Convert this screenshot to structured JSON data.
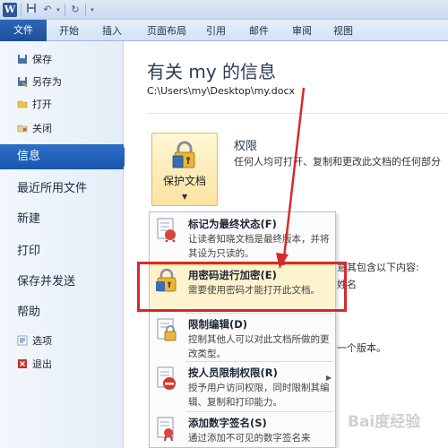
{
  "quick_access": {
    "logo": "W",
    "save_icon": "save-icon",
    "undo_icon": "undo-icon",
    "redo_icon": "redo-icon"
  },
  "tabs": [
    "文件",
    "开始",
    "插入",
    "页面布局",
    "引用",
    "邮件",
    "审阅",
    "视图"
  ],
  "nav": {
    "save": "保存",
    "save_as": "另存为",
    "open": "打开",
    "close": "关闭",
    "info": "信息",
    "recent": "最近所用文件",
    "new": "新建",
    "print": "打印",
    "save_send": "保存并发送",
    "help": "帮助",
    "options": "选项",
    "exit": "退出"
  },
  "main": {
    "title": "有关 my 的信息",
    "path": "C:\\Users\\my\\Desktop\\my.docx",
    "protect_label": "保护文档",
    "permissions_title": "权限",
    "permissions_desc": "任何人均可打开、复制和更改此文档的任何部分",
    "check_text": "意其包含以下内容:",
    "author_text": "姓名",
    "version_text": "一个版本。"
  },
  "menu": {
    "items": [
      {
        "title": "标记为最终状态(F)",
        "desc": "让读者知晓文档是最终版本，并将其设为只读的。"
      },
      {
        "title": "用密码进行加密(E)",
        "desc": "需要使用密码才能打开此文档。"
      },
      {
        "title": "限制编辑(D)",
        "desc": "控制其他人可以对此文档所做的更改类型。"
      },
      {
        "title": "按人员限制权限(R)",
        "desc": "授予用户访问权限，同时限制其编辑、复制和打印能力。"
      },
      {
        "title": "添加数字签名(S)",
        "desc": "通过添加不可见的数字签名来"
      }
    ]
  },
  "watermark": "Bai度经验",
  "colors": {
    "accent": "#1f5fb3",
    "highlight": "#d62a2a"
  }
}
